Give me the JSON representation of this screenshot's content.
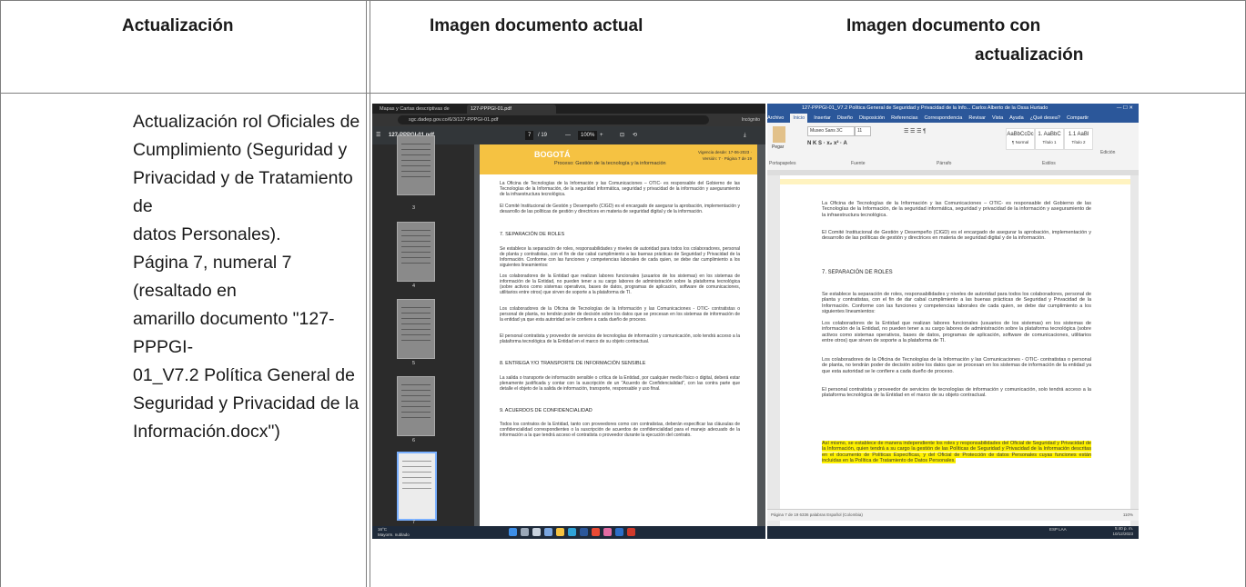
{
  "table": {
    "headers": [
      "Actualización",
      "Imagen documento actual",
      "Imagen documento con actualización"
    ],
    "header3_line1": "Imagen documento con",
    "header3_line2": "actualización",
    "description_lines": [
      "Actualización rol Oficiales de",
      "Cumplimiento (Seguridad y",
      "Privacidad y de Tratamiento de",
      "datos Personales).",
      "Página 7, numeral 7 (resaltado en",
      "amarillo documento \"127-PPPGI-",
      "01_V7.2 Política General de",
      "Seguridad y Privacidad de la",
      "Información.docx\")"
    ]
  },
  "pdf_viewer": {
    "tab1": "Mapas y Cartas descriptivas de",
    "tab2": "127-PPPGI-01.pdf",
    "url": "sgc.dadep.gov.co/6/3/127-PPPGI-01.pdf",
    "incognito": "Incógnito",
    "file_name": "127-PPPGI-01.pdf",
    "page_current": "7",
    "page_total": "/ 19",
    "zoom": "100%",
    "thumb_numbers": [
      "3",
      "4",
      "5",
      "6",
      "7"
    ],
    "header_logo": "BOGOTÁ",
    "header_process": "Proceso: Gestión de la tecnología y la información",
    "header_version": "Vigencia desde: 17-06-2023 · Versión: 7 · Página 7 de 19",
    "p1": "La Oficina de Tecnologías de la Información y las Comunicaciones – OTIC- es responsable del Gobierno de las Tecnologías de la Información, de la seguridad informática, seguridad y privacidad de la información y aseguramiento de la infraestructura tecnológica.",
    "p2": "El Comité Institucional de Gestión y Desempeño (CIGD) es el encargado de asegurar la aprobación, implementación y desarrollo de las políticas de gestión y directrices en materia de seguridad digital y de la información.",
    "h7": "7.   SEPARACIÓN DE ROLES",
    "p3": "Se establece la separación de roles, responsabilidades y niveles de autoridad para todos los colaboradores, personal de planta y contratistas, con el fin de dar cabal cumplimiento a las buenas prácticas de Seguridad y Privacidad de la Información. Conforme con las funciones y competencias laborales de cada quien, se debe dar cumplimiento a los siguientes lineamientos:",
    "p4": "Los colaboradores de la Entidad que realizan labores funcionales (usuarios de los sistemas) en los sistemas de información de la Entidad, no pueden tener a su cargo labores de administración sobre la plataforma tecnológica (sobre activos como sistemas operativos, bases de datos, programas de aplicación, software de comunicaciones, utilitarios entre otros) que sirven de soporte a la plataforma de TI.",
    "p5": "Los colaboradores de la Oficina de Tecnologías de la Información y las Comunicaciones - OTIC- contratistas o personal de planta, no tendrán poder de decisión sobre los datos que se procesan en los sistemas de información de la entidad ya que esta autoridad se le confiere a cada dueño de proceso.",
    "p6": "El personal contratista y proveedor de servicios de tecnologías de información y comunicación, solo tendrá acceso a la plataforma tecnológica de la Entidad en el marco de su objeto contractual.",
    "h8": "8.   ENTREGA Y/O TRANSPORTE DE INFORMACIÓN SENSIBLE",
    "p7": "La salida o transporte de información sensible o crítica de la Entidad, por cualquier medio físico o digital, deberá estar plenamente justificada y contar con la suscripción de un \"Acuerdo de Confidencialidad\", con las contra parte que detalle el objeto de la salida de información, transporte, responsable y uso final.",
    "h9": "9.   ACUERDOS DE CONFIDENCIALIDAD",
    "p8": "Todos los contratos de la Entidad, tanto con proveedores como con contratistas, deberán especificar las cláusulas de confidencialidad correspondientes o la suscripción de acuerdos de confidencialidad para el manejo adecuado de la información a la que tendrá acceso el contratista o proveedor durante la ejecución del contrato.",
    "weather_temp": "16°C",
    "weather_desc": "Mayorm. nublado"
  },
  "word": {
    "title": "127-PPPGI-01_V7.2 Política General de Seguridad y Privacidad de la Info...   Carlos Alberto de la Ossa Hurtado",
    "menu": [
      "Archivo",
      "Inicio",
      "Insertar",
      "Diseño",
      "Disposición",
      "Referencias",
      "Correspondencia",
      "Revisar",
      "Vista",
      "Ayuda",
      "¿Qué desea?",
      "Compartir"
    ],
    "font_name": "Museo Sans 3C",
    "font_size": "11",
    "styles": [
      "AaBbCcDc",
      "1. AaBbC",
      "1.1 AaBl"
    ],
    "style_names": [
      "¶ Normal",
      "Título 1",
      "Título 2"
    ],
    "groups": [
      "Portapapeles",
      "Fuente",
      "Párrafo",
      "Estilos",
      "Edición"
    ],
    "paste": "Pegar",
    "p1": "La Oficina de Tecnologías de la Información y las Comunicaciones – OTIC- es responsable del Gobierno de las Tecnologías de la Información, de la seguridad informática, seguridad y privacidad de la información y aseguramiento de la infraestructura tecnológica.",
    "p2": "El Comité Institucional de Gestión y Desempeño (CIGD) es el encargado de asegurar la aprobación, implementación y desarrollo de las políticas de gestión y directrices en materia de seguridad digital y de la información.",
    "h7": "7.   SEPARACIÓN DE ROLES",
    "p3": "Se establece la separación de roles, responsabilidades y niveles de autoridad para todos los colaboradores, personal de planta y contratistas, con el fin de dar cabal cumplimiento a las buenas prácticas de Seguridad y Privacidad de la Información. Conforme con las funciones y competencias laborales de cada quien, se debe dar cumplimiento a los siguientes lineamientos:",
    "p4": "Los colaboradores de la Entidad que realizan labores funcionales (usuarios de los sistemas) en los sistemas de información de la Entidad, no pueden tener a su cargo labores de administración sobre la plataforma tecnológica (sobre activos como sistemas operativos, bases de datos, programas de aplicación, software de comunicaciones, utilitarios entre otros) que sirven de soporte a la plataforma de TI.",
    "p5": "Los colaboradores de la Oficina de Tecnologías de la Información y las Comunicaciones - OTIC- contratistas o personal de planta, no tendrán poder de decisión sobre los datos que se procesan en los sistemas de información de la entidad ya que esta autoridad se le confiere a cada dueño de proceso.",
    "p6": "El personal contratista y proveedor de servicios de tecnologías de información y comunicación, solo tendrá acceso a la plataforma tecnológica de la Entidad en el marco de su objeto contractual.",
    "highlight": "Así mismo, se establece de manera independiente los roles y responsabilidades del Oficial de Seguridad y Privacidad de la Información, quien tendrá a su cargo la gestión de las Políticas de Seguridad y Privacidad de la Información descritas en el documento de Políticas Específicas, y del Oficial de Protección de datos Personales cuyas funciones están incluidas en la Política de Tratamiento de Datos Personales.",
    "status": "Página 7 de 19    6336 palabras    Español (Colombia)",
    "zoom": "110%",
    "clock": "5:40 p. m.",
    "date": "10/12/2023",
    "lang": "ESP LAA"
  }
}
